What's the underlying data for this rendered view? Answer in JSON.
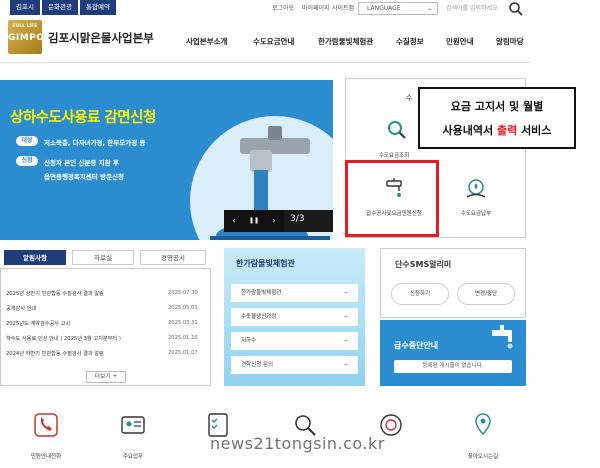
{
  "utility": {
    "tabs": [
      "김포시",
      "문화관광",
      "통합예약"
    ],
    "links": [
      "로그아웃",
      "마이페이지",
      "사이트맵"
    ],
    "language": "LANGUAGE",
    "search_placeholder": "검색어를 입력하세요"
  },
  "logo": {
    "top": "FULL LIFE",
    "main": "GIMPO"
  },
  "org_name": "김포시맑은물사업본부",
  "nav": [
    "사업본부소개",
    "수도요금안내",
    "한가람물빛체험관",
    "수질정보",
    "민원안내",
    "알림마당"
  ],
  "banner": {
    "title": "상하수도사용료 감면신청",
    "target_label": "대상",
    "target_text": "저소득층, 다자녀가정, 한부모가정 등",
    "apply_label": "신청",
    "apply_text1": "신청자 본인 신분증 지참 후",
    "apply_text2": "읍면동행정복지센터 방문신청",
    "prev": "‹",
    "pause": "❚❚",
    "next": "›",
    "counter": "3/3"
  },
  "quick": {
    "top_partial": "수",
    "items": [
      "수도요금조회",
      "급수공사및요금민원신청",
      "수도요금납부"
    ]
  },
  "callout": {
    "line1": "요금 고지서 및 월별",
    "line2_pre": "사용내역서 ",
    "line2_red": "출력",
    "line2_post": " 서비스"
  },
  "tabs": [
    "알림사항",
    "자료실",
    "경영공시"
  ],
  "notices": [
    {
      "title": "2025년 상반기 민관합동 수질검사 결과 알림",
      "date": "2025.07.30"
    },
    {
      "title": "공개감사 안내",
      "date": "2025.05.01"
    },
    {
      "title": "2025년도 계약검수공사 고시",
      "date": "2025.03.31"
    },
    {
      "title": "하수도 사용료 인상 안내 ( 2025년 3월 고지분부터 )",
      "date": "2025.01.10"
    },
    {
      "title": "2024년 하반기 민관합동 수질검사 결과 알림",
      "date": "2025.01.07"
    }
  ],
  "more": "더보기 +",
  "experience": {
    "title": "한가람물빛체험관",
    "rows": [
      "한가람물빛체험관",
      "수돗물생산과정",
      "지하수",
      "견학신청 문의"
    ]
  },
  "sms": {
    "title": "단수SMS알리미",
    "subscribe": "신청하기",
    "change": "변경/중단"
  },
  "outage": {
    "title": "급수중단안내",
    "status": "등록된 게시물이 없습니다."
  },
  "bottom": [
    "민원안내전화",
    "주요업무",
    "찾아오시는길"
  ],
  "watermark": "news21tongsin.co.kr",
  "colors": {
    "navy": "#1f3d7a",
    "banner_blue": "#2b8ccf",
    "banner_yellow": "#fff200",
    "highlight_red": "#e51c23",
    "gold": "#c9a23a"
  }
}
